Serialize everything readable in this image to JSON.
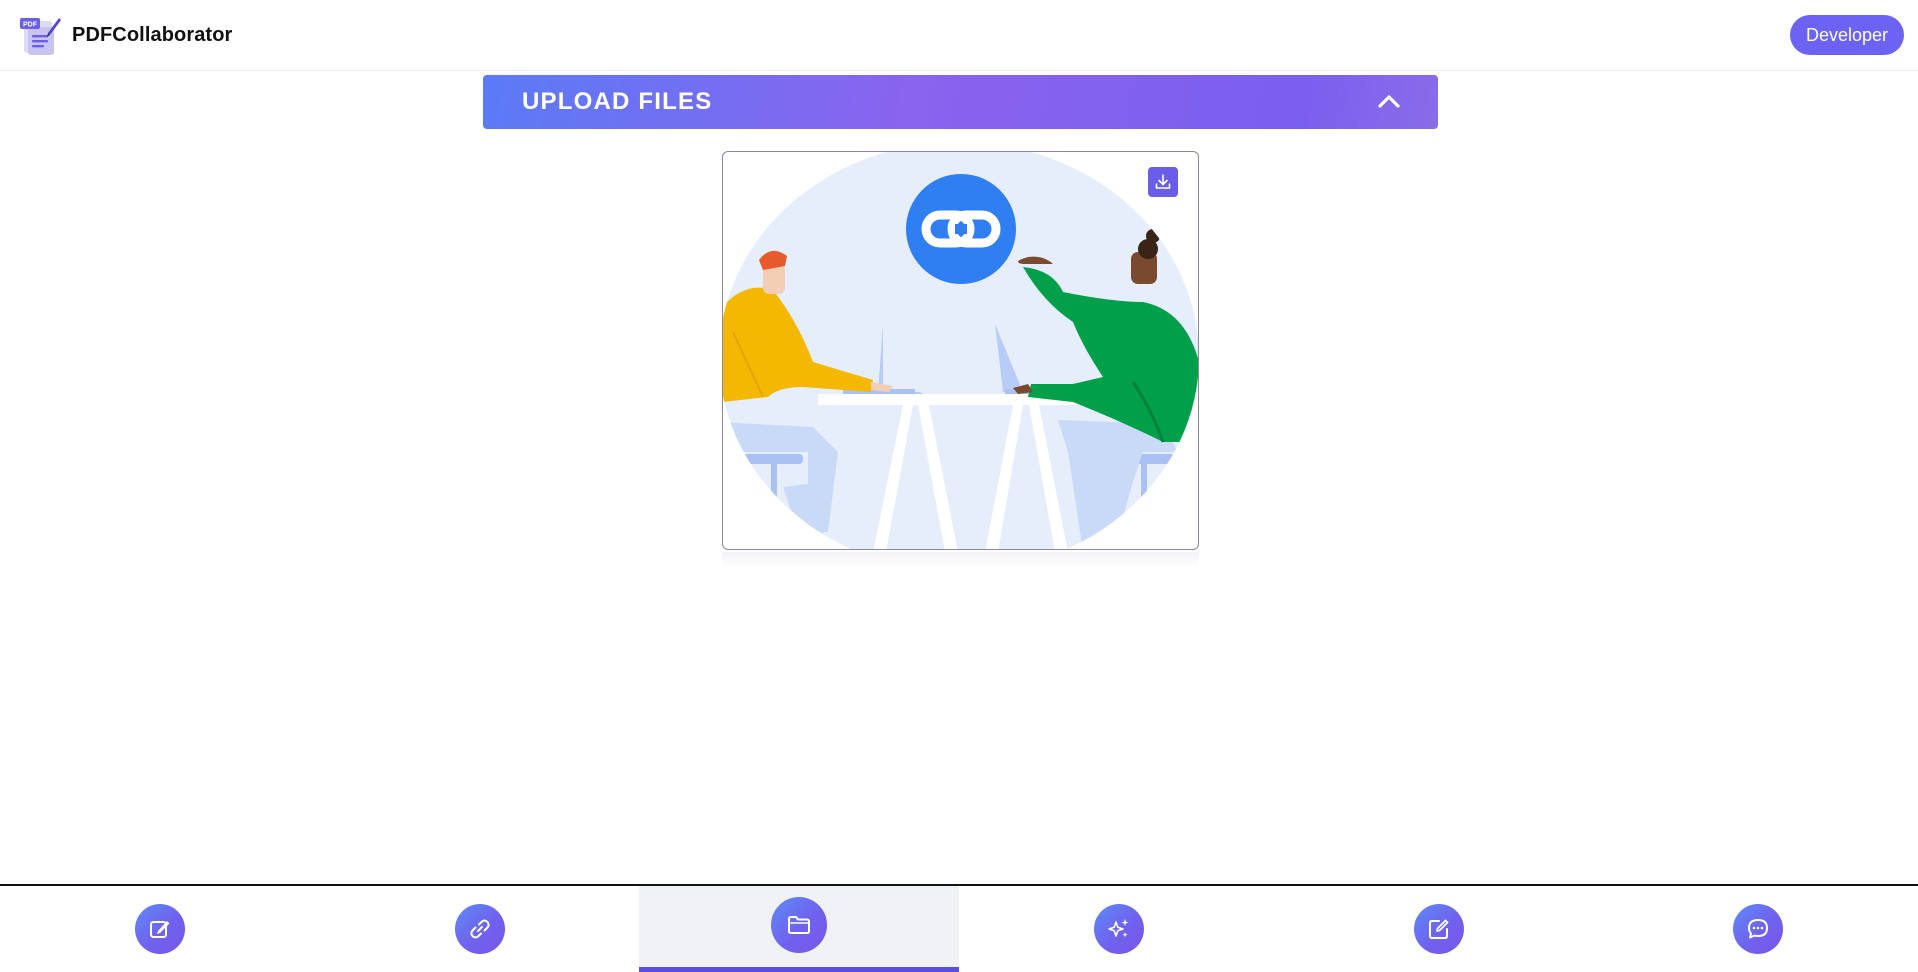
{
  "app": {
    "name": "PDFCollaborator",
    "logo_icon": "pdf-edit-logo",
    "logo_text": "PDF"
  },
  "header": {
    "developer_label": "Developer"
  },
  "upload": {
    "title": "UPLOAD FILES",
    "toggle_icon": "chevron-up-icon",
    "state": "expanded"
  },
  "card": {
    "illustration": "two-people-collaborating-link",
    "download_icon": "download-icon"
  },
  "nav": {
    "items": [
      {
        "icon": "edit-icon",
        "active": false
      },
      {
        "icon": "link-icon",
        "active": false
      },
      {
        "icon": "folder-icon",
        "active": true
      },
      {
        "icon": "sparkles-icon",
        "active": false
      },
      {
        "icon": "edit-square-icon",
        "active": false
      },
      {
        "icon": "chat-icon",
        "active": false
      }
    ]
  },
  "colors": {
    "accent": "#6c63f5",
    "upload_gradient_start": "#5b7bf6",
    "upload_gradient_end": "#8a63ee",
    "active_underline": "#5a4fdc"
  }
}
